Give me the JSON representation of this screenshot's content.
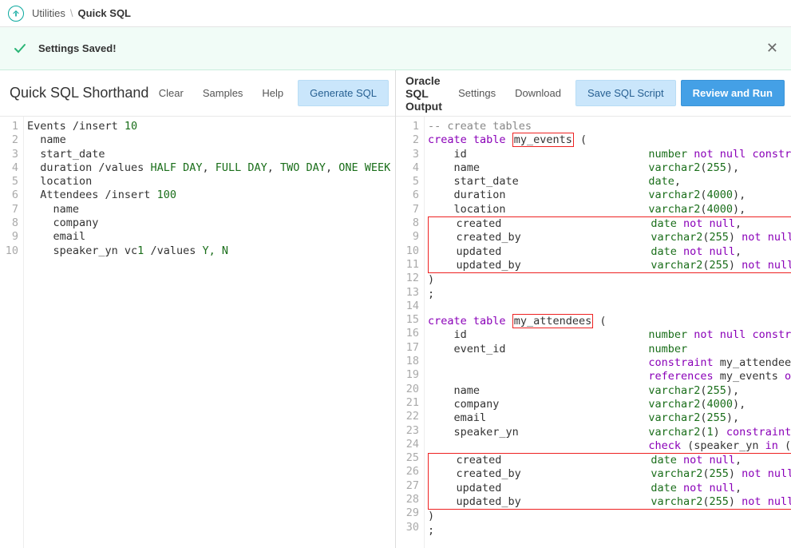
{
  "breadcrumb": {
    "parent": "Utilities",
    "sep": "\\",
    "current": "Quick SQL"
  },
  "banner": {
    "message": "Settings Saved!"
  },
  "left": {
    "title": "Quick SQL Shorthand",
    "clear": "Clear",
    "samples": "Samples",
    "help": "Help",
    "generate": "Generate SQL"
  },
  "right": {
    "title1": "Oracle",
    "title2": "SQL",
    "title3": "Output",
    "settings": "Settings",
    "download": "Download",
    "save": "Save SQL Script",
    "review": "Review and Run"
  },
  "shorthand_lines": [
    "Events /insert 10",
    "  name",
    "  start_date",
    "  duration /values HALF DAY, FULL DAY, TWO DAY, ONE WEEK",
    "  location",
    "  Attendees /insert 100",
    "    name",
    "    company",
    "    email",
    "    speaker_yn vc1 /values Y, N"
  ],
  "sql": {
    "audit_cols": [
      "created",
      "created_by",
      "updated",
      "updated_by"
    ],
    "t1": "my_events",
    "t2": "my_attendees"
  }
}
